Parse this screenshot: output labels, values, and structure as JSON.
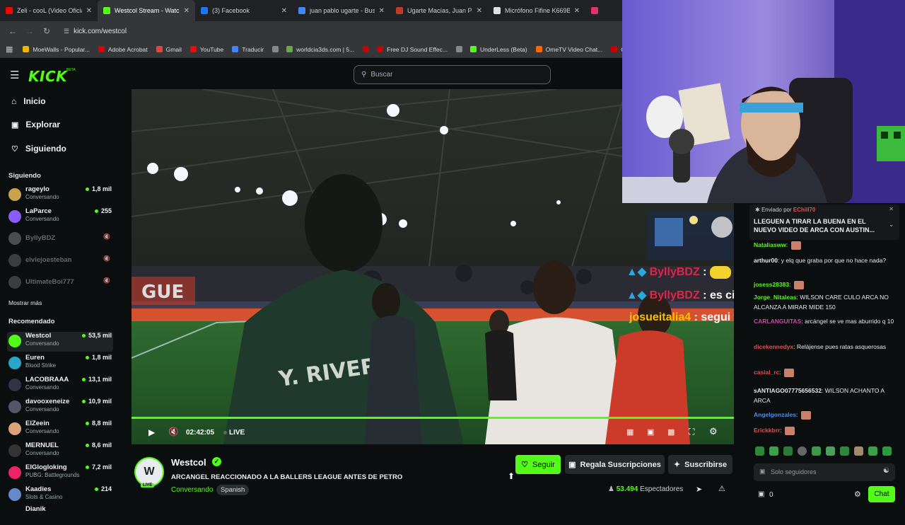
{
  "browser": {
    "tabs": [
      {
        "title": "Zeli - cooL (Video Oficial)",
        "color": "#ff0000"
      },
      {
        "title": "Westcol Stream - Watch L",
        "color": "#53fc18"
      },
      {
        "title": "(3) Facebook",
        "color": "#1877f2"
      },
      {
        "title": "juan pablo ugarte - Buscar",
        "color": "#4285f4"
      },
      {
        "title": "Ugarte Macías, Juan Pabl",
        "color": "#c0392b"
      },
      {
        "title": "Micrófono Fifine K669B C",
        "color": "#e0e0e0"
      },
      {
        "title": "",
        "color": "#e1306c"
      }
    ],
    "url": "kick.com/westcol",
    "bookmarks": [
      {
        "label": "MoeWalls - Popular...",
        "color": "#e9b600"
      },
      {
        "label": "Adobe Acrobat",
        "color": "#d00"
      },
      {
        "label": "Gmail",
        "color": "#ea4335"
      },
      {
        "label": "YouTube",
        "color": "#f00"
      },
      {
        "label": "Traducir",
        "color": "#4285f4"
      },
      {
        "label": "",
        "color": "#888"
      },
      {
        "label": "worldcia3ds.com | 5...",
        "color": "#6a4"
      },
      {
        "label": "",
        "color": "#c00"
      },
      {
        "label": "Free DJ Sound Effec...",
        "color": "#c00"
      },
      {
        "label": "",
        "color": "#888"
      },
      {
        "label": "UnderLess (Beta)",
        "color": "#53fc18"
      },
      {
        "label": "OmeTV Video Chat...",
        "color": "#f60"
      },
      {
        "label": "Ch",
        "color": "#c00"
      }
    ]
  },
  "kick": {
    "logo": "KICK",
    "logo_sup": "BETA",
    "search_placeholder": "Buscar"
  },
  "sidebar": {
    "nav": [
      {
        "label": "Inicio",
        "icon": "home-icon"
      },
      {
        "label": "Explorar",
        "icon": "compass-icon"
      },
      {
        "label": "Siguiendo",
        "icon": "heart-icon"
      }
    ],
    "following_title": "Siguiendo",
    "following": [
      {
        "name": "rageylo",
        "sub": "Conversando",
        "viewers": "1,8 mil",
        "color": "#c9a34b"
      },
      {
        "name": "LaParce",
        "sub": "Conversando",
        "viewers": "255",
        "color": "#8b5cf6"
      },
      {
        "name": "BylIyBDZ",
        "offline": true,
        "color": "#9a9a9a"
      },
      {
        "name": "elviejoesteban",
        "offline": true,
        "color": "#777"
      },
      {
        "name": "UltimateBoi777",
        "offline": true,
        "color": "#777"
      }
    ],
    "show_more": "Mostrar más",
    "recommended_title": "Recomendado",
    "recommended": [
      {
        "name": "Westcol",
        "sub": "Conversando",
        "viewers": "53,5 mil",
        "color": "#53fc18",
        "selected": true
      },
      {
        "name": "Euren",
        "sub": "Blood Strike",
        "viewers": "1,8 mil",
        "color": "#2aa7c8"
      },
      {
        "name": "LACOBRAAA",
        "sub": "Conversando",
        "viewers": "13,1 mil",
        "color": "#334"
      },
      {
        "name": "davooxeneize",
        "sub": "Conversando",
        "viewers": "10,9 mil",
        "color": "#556"
      },
      {
        "name": "ElZeein",
        "sub": "Conversando",
        "viewers": "8,8 mil",
        "color": "#d9a47a"
      },
      {
        "name": "MERNUEL",
        "sub": "Conversando",
        "viewers": "8,6 mil",
        "color": "#333"
      },
      {
        "name": "ElGlogloking",
        "sub": "PUBG: Battlegrounds",
        "viewers": "7,2 mil",
        "color": "#e26"
      },
      {
        "name": "Kaadies",
        "sub": "Slots & Casino",
        "viewers": "214",
        "color": "#68c"
      }
    ],
    "extra_partial": "Dianik"
  },
  "player": {
    "time": "02:42:05",
    "live": "LIVE",
    "jersey_text": "Y. RIVERA",
    "banner_text": "GUE",
    "overlay_chat": [
      {
        "user": "ByllyBDZ",
        "sep": " : ",
        "text": ""
      },
      {
        "user": "ByllyBDZ",
        "sep": " : ",
        "text": "es cierto"
      },
      {
        "user": "josueitalia4",
        "sep": " : ",
        "text": "segui tu consejo le metí de todo"
      }
    ]
  },
  "stream": {
    "channel": "Westcol",
    "title": "ARCANGEL REACCIONADO A LA BALLERS LEAGUE ANTES DE PETRO",
    "category": "Conversando",
    "language": "Spanish",
    "live_badge": "LIVE",
    "follow": "Seguir",
    "gift": "Regala Suscripciones",
    "subscribe": "Suscribirse",
    "viewers": "53.494",
    "viewers_label": "Espectadores"
  },
  "chat": {
    "pinned_by": "Enviado por",
    "pinned_user": "EChill70",
    "pinned_text": "LLEGUEN A TIRAR LA BUENA EN EL NUEVO VIDEO DE ARCA CON AUSTIN...",
    "messages": [
      {
        "user": "Nataliasww",
        "text": "",
        "color": "#53fc18"
      },
      {
        "user": "arthur00",
        "text": "y elq que graba por que no hace nada?",
        "color": "#e8e8e8"
      },
      {
        "user": "josess28383",
        "text": "",
        "color": "#53fc18"
      },
      {
        "user": "Jorge_Nitaleas",
        "text": "WILSON CARE CULO ARCA NO ALCANZA A MIRAR MIDE 150",
        "color": "#53fc18"
      },
      {
        "user": "CARLANGUITAS",
        "text": "arcángel se ve mas aburrido q 10",
        "color": "#c94aa8"
      },
      {
        "user": "dicekennedyx",
        "text": "Relájense pues ratas asquerosas",
        "color": "#e05050"
      },
      {
        "user": "casial_rc",
        "text": "",
        "color": "#e05050"
      },
      {
        "user": "sANTIAGO07775656532",
        "text": "WILSON ACHANTO A ARCA",
        "color": "#e8e8e8"
      },
      {
        "user": "Angelgonzales",
        "text": "",
        "color": "#4a8ef0"
      },
      {
        "user": "Erickkbrr",
        "text": "",
        "color": "#e05050"
      }
    ],
    "input_placeholder": "Solo seguidores",
    "points": "0",
    "send": "Chat"
  },
  "colors": {
    "accent": "#53fc18",
    "bg": "#0b0e0f"
  }
}
